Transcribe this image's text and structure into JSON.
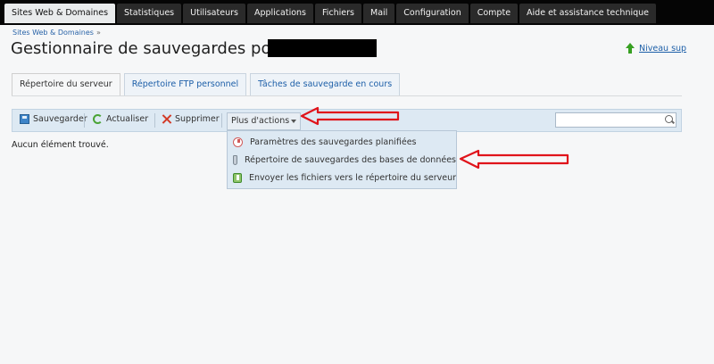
{
  "topnav": {
    "tabs": [
      {
        "label": "Sites Web & Domaines"
      },
      {
        "label": "Statistiques"
      },
      {
        "label": "Utilisateurs"
      },
      {
        "label": "Applications"
      },
      {
        "label": "Fichiers"
      },
      {
        "label": "Mail"
      },
      {
        "label": "Configuration"
      },
      {
        "label": "Compte"
      },
      {
        "label": "Aide et assistance technique"
      }
    ],
    "active": "Sites Web & Domaines"
  },
  "breadcrumb": {
    "item": "Sites Web & Domaines",
    "separator": "»"
  },
  "page": {
    "title": "Gestionnaire de sauvegardes pour",
    "up_link": "Niveau sup"
  },
  "content_tabs": [
    "Répertoire du serveur",
    "Répertoire FTP personnel",
    "Tâches de sauvegarde en cours"
  ],
  "toolbar": {
    "save_label": "Sauvegarder",
    "refresh_label": "Actualiser",
    "delete_label": "Supprimer",
    "more_label": "Plus d'actions",
    "search_placeholder": ""
  },
  "empty_message": "Aucun élément trouvé.",
  "more_menu": {
    "items": [
      {
        "label": "Paramètres des sauvegardes planifiées",
        "icon": "clock-icon"
      },
      {
        "label": "Répertoire de sauvegardes des bases de données",
        "icon": "database-icon"
      },
      {
        "label": "Envoyer les fichiers vers le répertoire du serveur",
        "icon": "upload-icon"
      }
    ]
  },
  "colors": {
    "topbar": "#050505",
    "link": "#1d5fa8",
    "toolbar": "#dde9f3",
    "annotation_arrow": "#e0141b"
  },
  "icons": [
    "save-icon",
    "refresh-icon",
    "delete-icon",
    "search-icon",
    "up-arrow-icon"
  ]
}
